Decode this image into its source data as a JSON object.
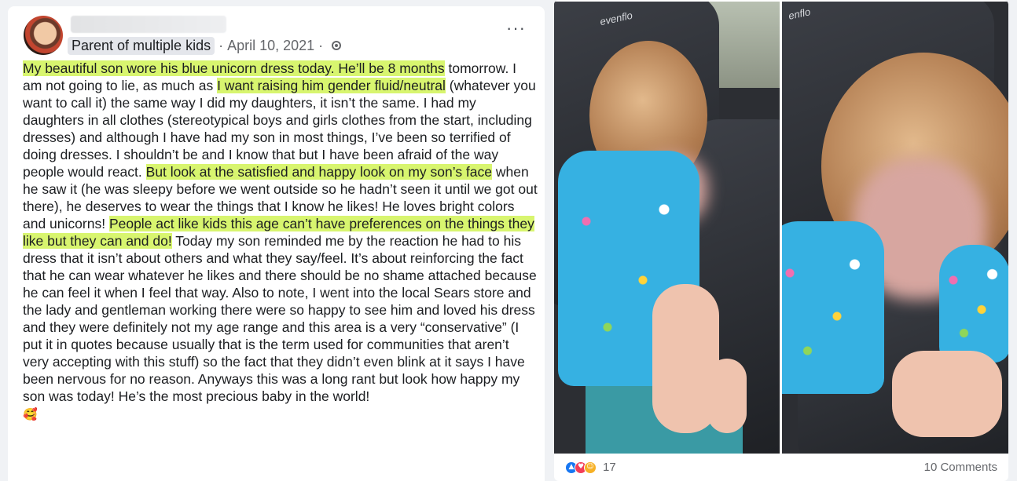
{
  "post": {
    "author_group_badge": "Parent of multiple kids",
    "separator": "·",
    "date": "April 10, 2021",
    "audience_icon": "globe-icon",
    "more_label": "···",
    "text_segments": [
      {
        "t": "My beautiful son wore his blue unicorn dress today. He’ll be 8 months",
        "hl": true
      },
      {
        "t": " tomorrow. I am not going to lie, as much as ",
        "hl": false
      },
      {
        "t": "I want raising him gender fluid/neutral",
        "hl": true
      },
      {
        "t": " (whatever you want to call it) the same way I did my daughters, it isn’t the same. I had my daughters in all clothes (stereotypical boys and girls clothes from the start, including dresses) and although I have had my son in most things, I’ve been so terrified of doing dresses. I shouldn’t be and I know that but I have been afraid of the way people would react. ",
        "hl": false
      },
      {
        "t": "But look at the satisfied and happy look on my son’s face",
        "hl": true
      },
      {
        "t": " when he saw it (he was sleepy before we went outside so he hadn’t seen it until we got out there), he deserves to wear the things that I know he likes! He loves bright colors and unicorns! ",
        "hl": false
      },
      {
        "t": "People act like kids this age can’t have preferences on the things they like but they can and do!",
        "hl": true
      },
      {
        "t": " Today my son reminded me by the reaction he had to his dress that it isn’t about others and what they say/feel. It’s about reinforcing the fact that he can wear whatever he likes and there should be no shame attached because he can feel it when I feel that way. Also to note, I went into the local Sears store and the lady and gentleman working there were so happy to see him and loved his dress and they were definitely not my age range and this area is a very “conservative” (I put it in quotes because usually that is the term used for communities that aren’t very accepting with this stuff) so the fact that they didn’t even blink at it says I have been nervous for no reason. Anyways this was a long rant but look how happy my son was today! He’s the most precious baby in the world!",
        "hl": false
      }
    ],
    "trailing_emoji": "🥰"
  },
  "photo_panel": {
    "brand_text_1": "evenflo",
    "brand_text_2": "enflo",
    "reaction_icons": [
      "like-icon",
      "love-icon",
      "care-icon"
    ],
    "reaction_count": "17",
    "comments_label": "10 Comments"
  },
  "colors": {
    "highlight": "#d8f56f",
    "dress_blue": "#36b1e2",
    "link_gray": "#65676b"
  }
}
